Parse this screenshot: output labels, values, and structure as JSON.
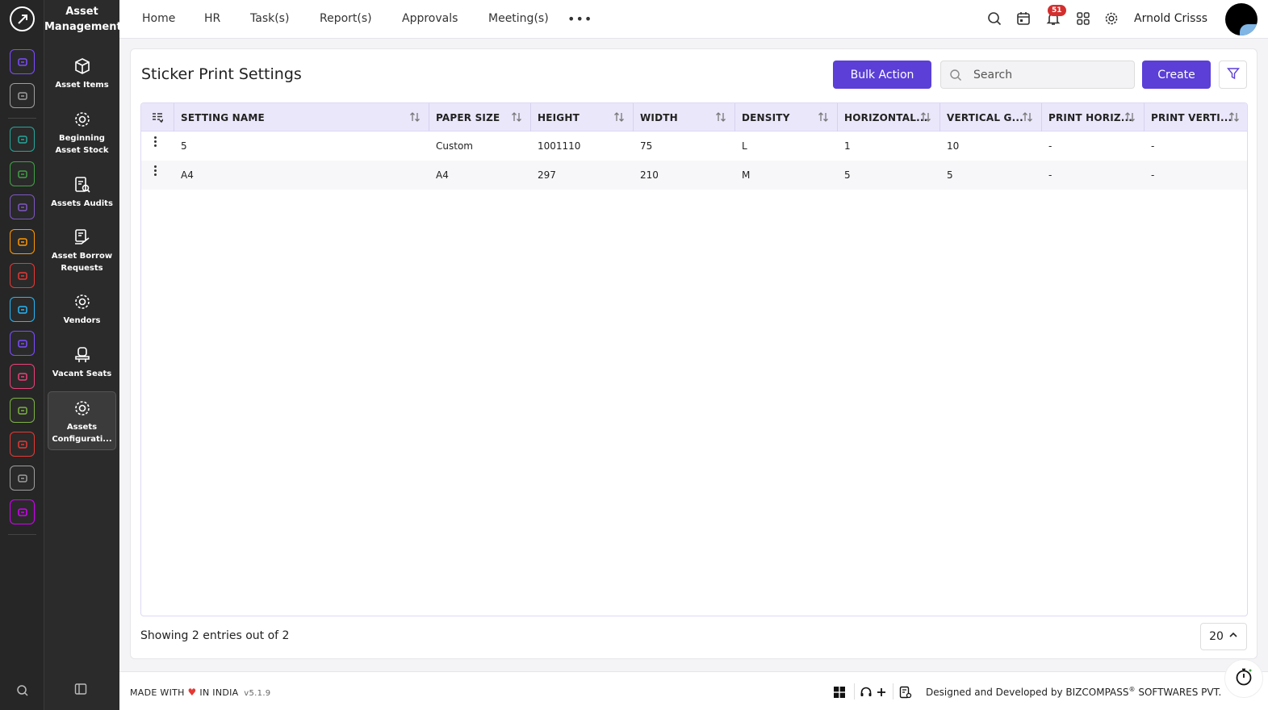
{
  "module": {
    "title": "Asset Management"
  },
  "rail": {
    "colors": [
      "#7c4dff",
      "#9e9e9e",
      "#26a69a",
      "#43a047",
      "#7e57c2",
      "#ff9800",
      "#e53935",
      "#29b6f6",
      "#7c4dff",
      "#ec407a",
      "#7cb342",
      "#e53935",
      "#9e9e9e",
      "#d500f9"
    ]
  },
  "sidebar": {
    "items": [
      {
        "label": "Asset Items",
        "icon": "cube-icon"
      },
      {
        "label": "Beginning Asset Stock",
        "icon": "gear-icon"
      },
      {
        "label": "Assets Audits",
        "icon": "audit-icon"
      },
      {
        "label": "Asset Borrow Requests",
        "icon": "borrow-icon"
      },
      {
        "label": "Vendors",
        "icon": "gear-icon"
      },
      {
        "label": "Vacant Seats",
        "icon": "seat-icon"
      },
      {
        "label": "Assets Configurati...",
        "icon": "gear-icon"
      }
    ]
  },
  "topnav": {
    "items": [
      "Home",
      "HR",
      "Task(s)",
      "Report(s)",
      "Approvals",
      "Meeting(s)"
    ],
    "more": "•••",
    "notification_count": "51",
    "user_name": "Arnold Crisss"
  },
  "page": {
    "title": "Sticker Print Settings",
    "bulk_action_label": "Bulk Action",
    "search_placeholder": "Search",
    "create_label": "Create"
  },
  "table": {
    "columns": [
      "SETTING NAME",
      "PAPER SIZE",
      "HEIGHT",
      "WIDTH",
      "DENSITY",
      "HORIZONTAL...",
      "VERTICAL G...",
      "PRINT HORIZ...",
      "PRINT VERTI..."
    ],
    "rows": [
      [
        "5",
        "Custom",
        "1001110",
        "75",
        "L",
        "1",
        "10",
        "-",
        "-"
      ],
      [
        "A4",
        "A4",
        "297",
        "210",
        "M",
        "5",
        "5",
        "-",
        "-"
      ]
    ]
  },
  "footer": {
    "showing": "Showing 2 entries out of 2",
    "page_size": "20"
  },
  "bottombar": {
    "made_prefix": "MADE WITH",
    "made_suffix": "IN INDIA",
    "version": "v5.1.9",
    "designed_prefix": "Designed and Developed by",
    "company": "BIZCOMPASS",
    "company_suffix": "SOFTWARES PVT."
  }
}
